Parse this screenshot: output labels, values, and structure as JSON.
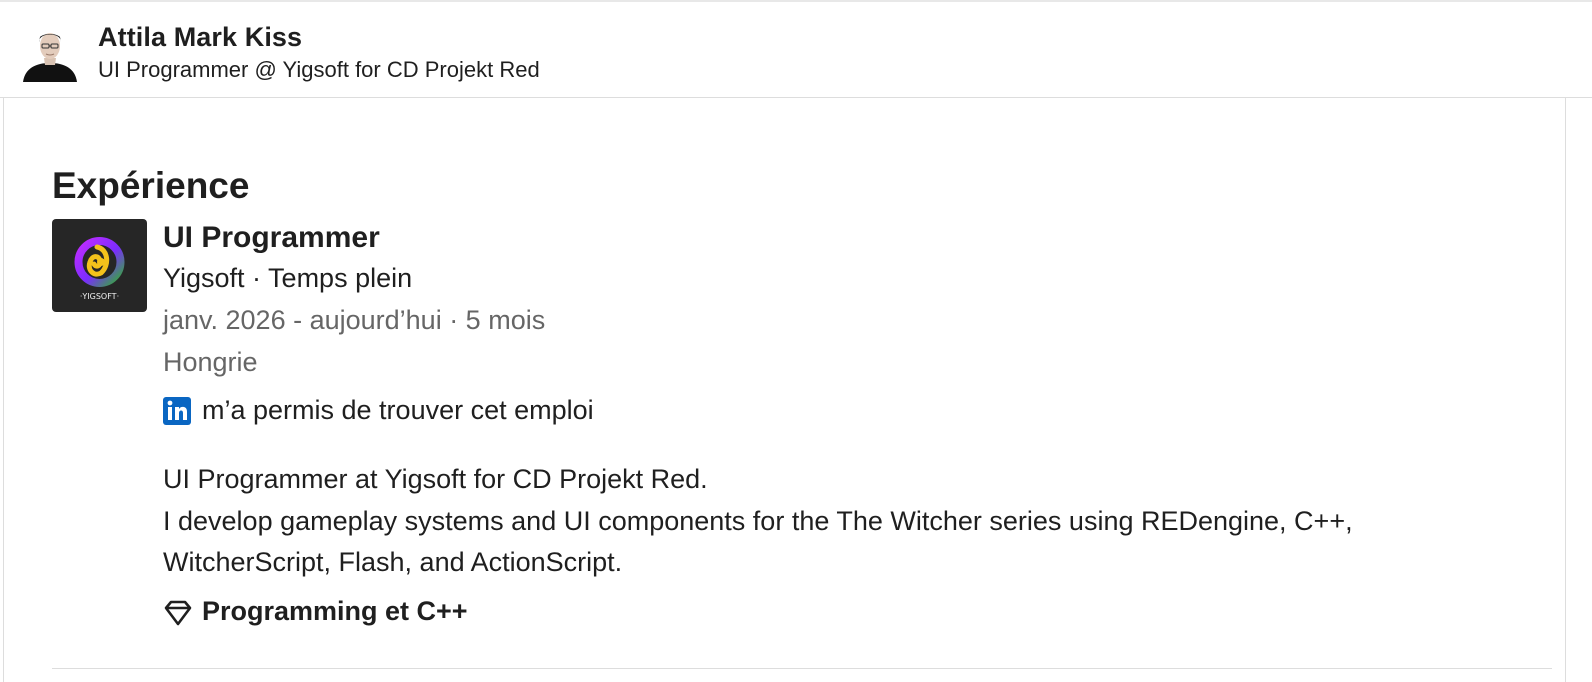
{
  "profile": {
    "name": "Attila Mark Kiss",
    "headline": "UI Programmer @ Yigsoft for CD Projekt Red"
  },
  "experience": {
    "section_title": "Expérience",
    "items": [
      {
        "logo_icon": "yigsoft-logo-icon",
        "logo_text": "·YIGSOFT·",
        "title": "UI Programmer",
        "company_line": "Yigsoft · Temps plein",
        "dates_line": "janv. 2026 - aujourd’hui · 5 mois",
        "location": "Hongrie",
        "linkedin_note": "m’a permis de trouver cet emploi",
        "description": [
          "UI Programmer at Yigsoft for CD Projekt Red.",
          "I develop gameplay systems and UI components for the The Witcher series using REDengine, C++, WitcherScript, Flash, and ActionScript."
        ],
        "skills": "Programming et C++"
      }
    ]
  },
  "colors": {
    "text_primary": "#1f1f1f",
    "text_secondary": "#666666",
    "linkedin_blue": "#0a66c2",
    "divider": "#dddddd"
  }
}
